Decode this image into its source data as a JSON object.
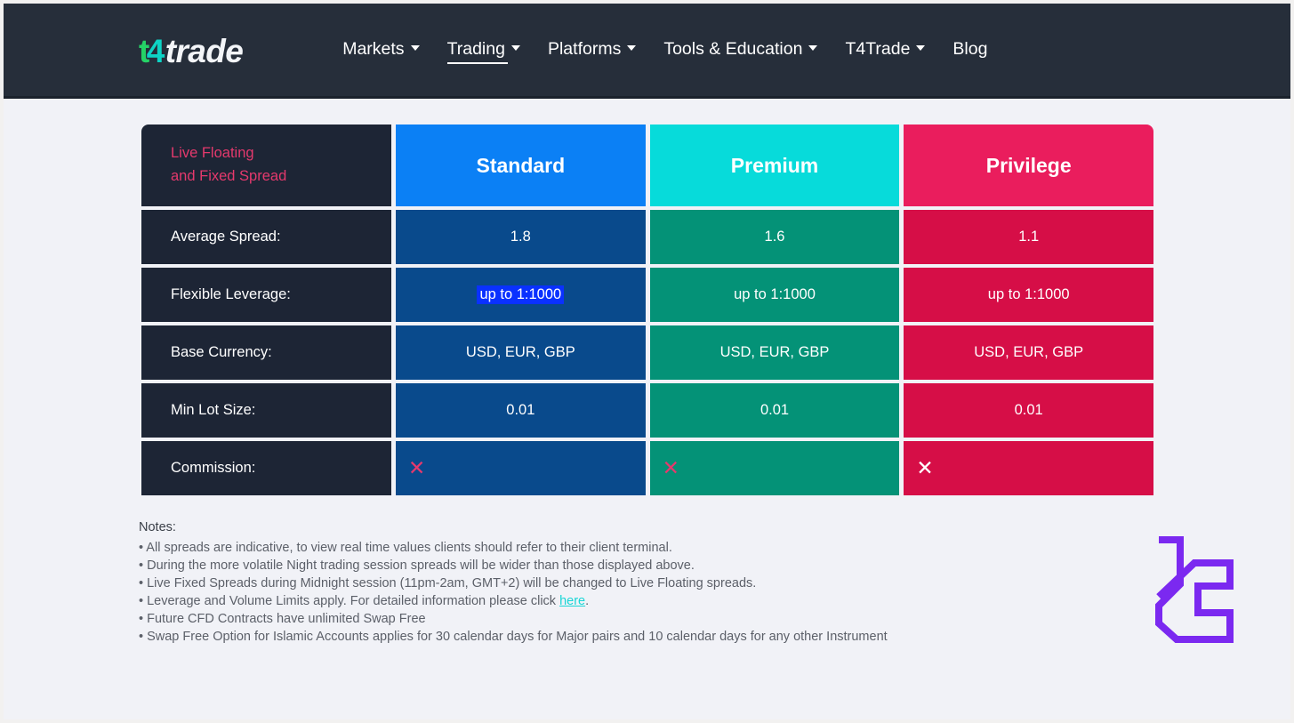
{
  "header": {
    "logo": {
      "part1": "t",
      "part2": "4",
      "part3": "trade"
    },
    "nav": [
      {
        "label": "Markets",
        "has_caret": true,
        "active": false
      },
      {
        "label": "Trading",
        "has_caret": true,
        "active": true
      },
      {
        "label": "Platforms",
        "has_caret": true,
        "active": false
      },
      {
        "label": "Tools & Education",
        "has_caret": true,
        "active": false
      },
      {
        "label": "T4Trade",
        "has_caret": true,
        "active": false
      },
      {
        "label": "Blog",
        "has_caret": false,
        "active": false
      }
    ]
  },
  "table": {
    "corner": {
      "line1": "Live Floating",
      "line2": "and Fixed Spread"
    },
    "columns": [
      {
        "name": "Standard",
        "color": "#0b80f5",
        "body_color": "#094a8c"
      },
      {
        "name": "Premium",
        "color": "#07dbda",
        "body_color": "#049277"
      },
      {
        "name": "Privilege",
        "color": "#ea1d5d",
        "body_color": "#d60e47"
      }
    ],
    "rows": [
      {
        "label": "Average Spread:",
        "standard": "1.8",
        "premium": "1.6",
        "privilege": "1.1"
      },
      {
        "label": "Flexible Leverage:",
        "standard": "up to 1:1000",
        "premium": "up to 1:1000",
        "privilege": "up to 1:1000"
      },
      {
        "label": "Base Currency:",
        "standard": "USD, EUR, GBP",
        "premium": "USD, EUR, GBP",
        "privilege": "USD, EUR, GBP"
      },
      {
        "label": "Min Lot Size:",
        "standard": "0.01",
        "premium": "0.01",
        "privilege": "0.01"
      }
    ],
    "commission": {
      "label": "Commission:",
      "standard_mark": "✕",
      "premium_mark": "✕",
      "privilege_mark": "✕"
    },
    "selection_highlight": "up to 1:1000"
  },
  "notes": {
    "title": "Notes:",
    "items": [
      "• All spreads are indicative, to view real time values clients should refer to their client terminal.",
      "• During the more volatile Night trading session spreads will be wider than those displayed above.",
      "• Live Fixed Spreads during Midnight session (11pm-2am, GMT+2) will be changed to Live Floating spreads.",
      "• Future CFD Contracts have unlimited Swap Free",
      "• Swap Free Option for Islamic Accounts applies for 30 calendar days for Major pairs and 10 calendar days for any other Instrument"
    ],
    "leverage_note_prefix": "• Leverage and Volume Limits apply. For detailed information please click ",
    "leverage_note_link": "here",
    "leverage_note_suffix": "."
  },
  "watermark": {
    "name": "brand-mark",
    "color": "#7b29f0"
  }
}
